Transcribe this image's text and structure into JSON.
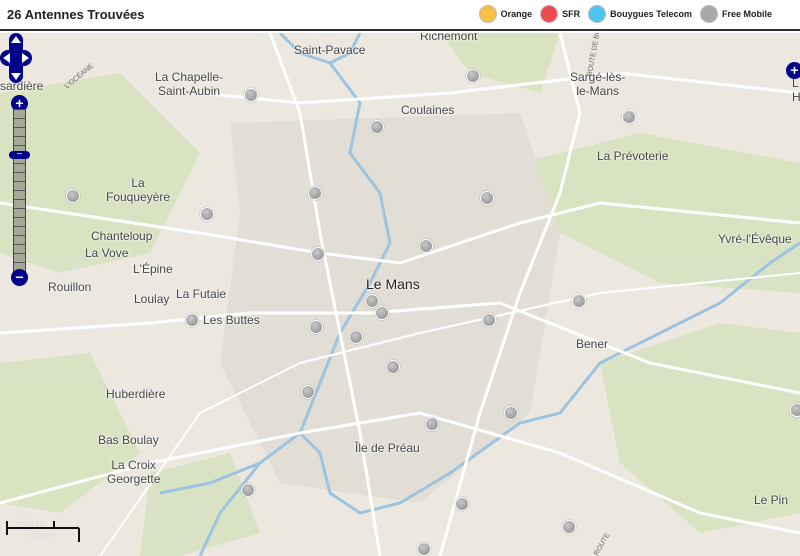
{
  "header": {
    "title": "26 Antennes Trouvées"
  },
  "legend": [
    {
      "label": "Orange",
      "color": "#f9c043"
    },
    {
      "label": "SFR",
      "color": "#f04a4f"
    },
    {
      "label": "Bouygues Telecom",
      "color": "#4fc3f0"
    },
    {
      "label": "Free Mobile",
      "color": "#a9a9a9"
    }
  ],
  "map": {
    "labels": {
      "richemont": "Richemont",
      "saint_pavace": "Saint-Pavace",
      "chapelle": "La Chapelle-\nSaint-Aubin",
      "sarge": "Sargé-lès-\nle-Mans",
      "coulaines": "Coulaines",
      "prevoterie": "La Prévoterie",
      "fouqueyere": "La\nFouqueyère",
      "chanteloup": "Chanteloup",
      "la_vove": "La Vove",
      "epine": "L'Épine",
      "yvre": "Yvré-l'Évêque",
      "rouillon": "Rouillon",
      "loulay": "Loulay",
      "futaie": "La Futaie",
      "le_mans": "Le Mans",
      "les_buttes": "Les Buttes",
      "bener": "Bener",
      "huberdiere": "Huberdière",
      "bas_boulay": "Bas Boulay",
      "ile_preau": "Île de Préau",
      "croix": "La Croix\nGeorgette",
      "le_pin": "Le Pin",
      "sardiere": "ssardière",
      "l_partial": "L\nH"
    },
    "roads": {
      "oceane": "L'OCÉANE",
      "bonnetable": "ROUTE DE BONNÉTABLE",
      "route_bottom": "ROUTE"
    },
    "scale": {
      "metric": "1000 m",
      "imperial": "5000 ft"
    },
    "antenna_count": 26
  },
  "controls": {
    "zoom_in": "+",
    "zoom_out": "−",
    "slider_handle": "−",
    "right_zoom_in": "+"
  }
}
